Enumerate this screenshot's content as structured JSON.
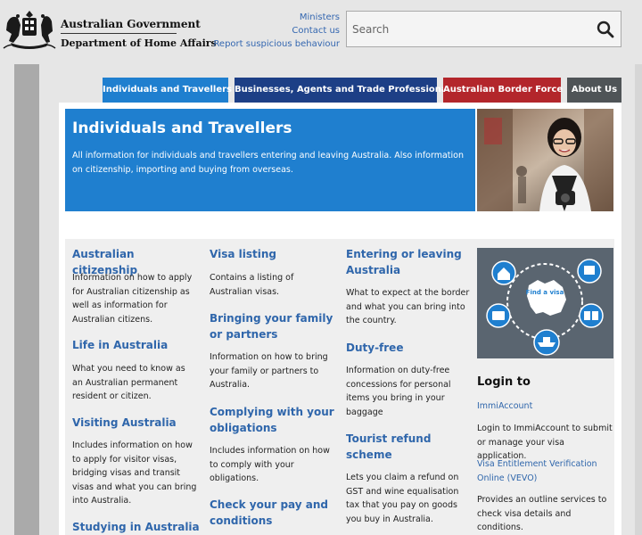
{
  "header": {
    "gov_line1": "Australian Government",
    "gov_line2": "Department of Home Affairs",
    "links": [
      "Ministers",
      "Contact us",
      "Report suspicious behaviour"
    ],
    "search_placeholder": "Search",
    "search_icon": "search-icon"
  },
  "nav": {
    "items": [
      {
        "label": "Individuals and Travellers",
        "color": "#1f7fcf"
      },
      {
        "label": "Businesses, Agents and Trade Professionals",
        "color": "#1d3f86"
      },
      {
        "label": "Australian Border Force",
        "color": "#b3262b"
      },
      {
        "label": "About Us",
        "color": "#4f5457"
      }
    ]
  },
  "hero": {
    "title": "Individuals and Travellers",
    "description": "All information for individuals and travellers entering and leaving Australia. Also information on citizenship, importing and buying from overseas."
  },
  "columns": {
    "col1": [
      {
        "title": "Australian citizenship",
        "desc": "Information on how to apply for Australian citizenship as well as information for Australian citizens."
      },
      {
        "title": "Life in Australia",
        "desc": "What you need to know as an Australian permanent resident or citizen."
      },
      {
        "title": "Visiting Australia",
        "desc": "Includes information on how to apply for visitor visas, bridging visas and transit visas and what you can bring into Australia."
      },
      {
        "title": "Studying in Australia",
        "desc": ""
      }
    ],
    "col2": [
      {
        "title": "Visa listing",
        "desc": "Contains a listing of Australian visas."
      },
      {
        "title": "Bringing your family or partners",
        "desc": "Information on how to bring your family or partners to Australia."
      },
      {
        "title": "Complying with your obligations",
        "desc": "Includes information on how to comply with your obligations."
      },
      {
        "title": "Check your pay and conditions",
        "desc": ""
      }
    ],
    "col3": [
      {
        "title": "Entering or leaving Australia",
        "desc": "What to expect at the border and what you can bring into the country."
      },
      {
        "title": "Duty-free",
        "desc": "Information on duty-free concessions for personal items you bring in your baggage"
      },
      {
        "title": "Tourist refund scheme",
        "desc": "Lets you claim a refund on GST and wine equalisation tax that you pay on goods you buy in Australia."
      }
    ]
  },
  "sidebar": {
    "visa_graphic_label": "Find a visa",
    "login_title": "Login to",
    "immi_link": "ImmiAccount",
    "immi_desc": "Login to ImmiAccount to submit or manage your visa application.",
    "vevo_link": "Visa Entitlement Verification Online (VEVO)",
    "vevo_desc": "Provides an outline services to check visa details and conditions."
  }
}
